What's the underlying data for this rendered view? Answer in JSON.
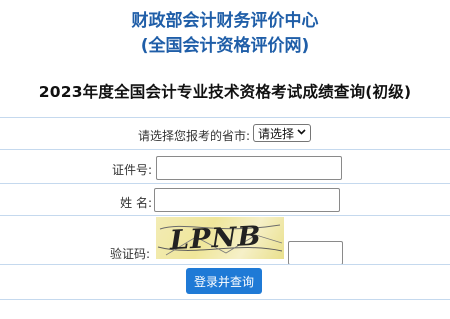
{
  "header": {
    "org_line1": "财政部会计财务评价中心",
    "org_line2": "(全国会计资格评价网)",
    "title": "2023年度全国会计专业技术资格考试成绩查询(初级)"
  },
  "form": {
    "province_label": "请选择您报考的省市:",
    "province_value": "请选择",
    "id_label": "证件号:",
    "id_value": "",
    "name_label": "姓 名:",
    "name_value": "",
    "captcha_label": "验证码:",
    "captcha_text": "LPNB",
    "captcha_value": "",
    "submit_label": "登录并查询"
  },
  "colors": {
    "accent": "#1f5ea8",
    "button": "#1f7ad6",
    "divider": "#c5d9ee"
  }
}
